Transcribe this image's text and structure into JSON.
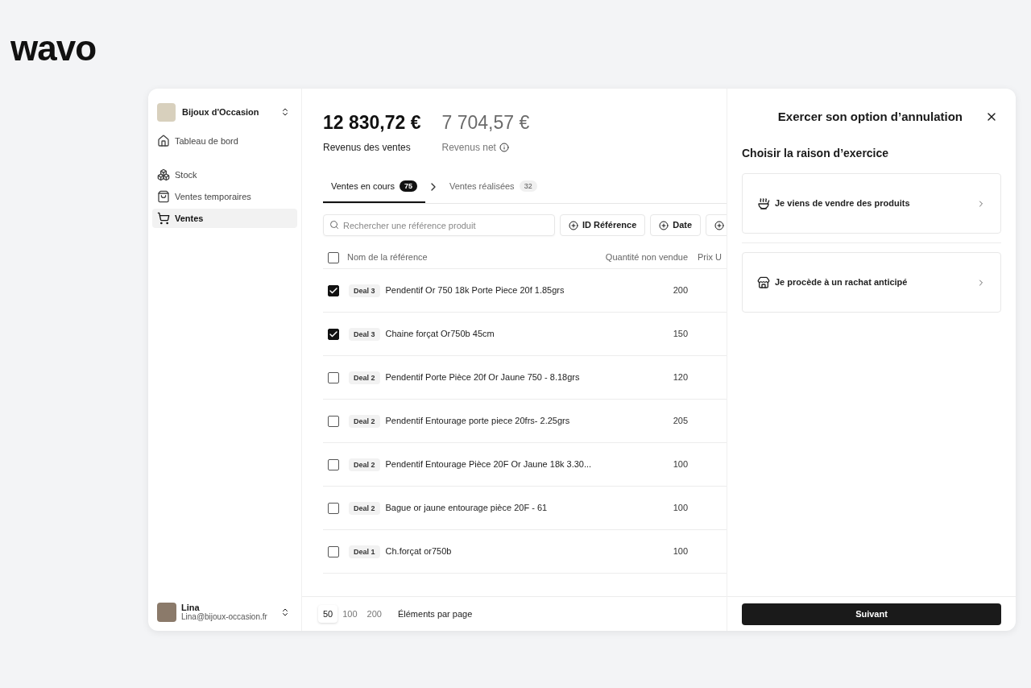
{
  "logo": "wavo",
  "sidebar": {
    "store_name": "Bijoux d'Occasion",
    "items": [
      {
        "label": "Tableau de bord",
        "selected": false
      },
      {
        "label": "Stock",
        "selected": false
      },
      {
        "label": "Ventes temporaires",
        "selected": false
      },
      {
        "label": "Ventes",
        "selected": true
      }
    ],
    "user": {
      "name": "Lina",
      "email": "Lina@bijoux-occasion.fr"
    }
  },
  "stats": [
    {
      "value": "12 830,72 €",
      "label": "Revenus des ventes"
    },
    {
      "value": "7 704,57 €",
      "label": "Revenus net"
    }
  ],
  "tabs": [
    {
      "label": "Ventes en cours",
      "count": "75",
      "selected": true
    },
    {
      "label": "Ventes réalisées",
      "count": "32",
      "selected": false
    }
  ],
  "search": {
    "placeholder": "Rechercher une référence produit"
  },
  "filters": [
    "ID Référence",
    "Date"
  ],
  "table": {
    "select_all": false,
    "columns": [
      "Nom de la référence",
      "Quantité non vendue",
      "Prix U"
    ],
    "rows": [
      {
        "checked": true,
        "deal": "Deal 3",
        "name": "Pendentif Or 750 18k Porte Piece 20f 1.85grs",
        "quantity": "200"
      },
      {
        "checked": true,
        "deal": "Deal 3",
        "name": "Chaine forçat Or750b 45cm",
        "quantity": "150"
      },
      {
        "checked": false,
        "deal": "Deal 2",
        "name": "Pendentif Porte Pièce 20f Or Jaune 750 - 8.18grs",
        "quantity": "120"
      },
      {
        "checked": false,
        "deal": "Deal 2",
        "name": "Pendentif Entourage porte piece 20frs- 2.25grs",
        "quantity": "205"
      },
      {
        "checked": false,
        "deal": "Deal 2",
        "name": "Pendentif Entourage Pièce 20F Or Jaune 18k 3.30...",
        "quantity": "100"
      },
      {
        "checked": false,
        "deal": "Deal 2",
        "name": "Bague or jaune entourage pièce 20F - 61",
        "quantity": "100"
      },
      {
        "checked": false,
        "deal": "Deal 1",
        "name": "Ch.forçat or750b",
        "quantity": "100"
      }
    ]
  },
  "pagination": {
    "options": [
      {
        "label": "50",
        "selected": true
      },
      {
        "label": "100",
        "selected": false
      },
      {
        "label": "200",
        "selected": false
      }
    ],
    "label": "Éléments par page"
  },
  "panel": {
    "title": "Exercer son option d’annulation",
    "subtitle": "Choisir la raison d’exercice",
    "options": [
      {
        "label": "Je viens de vendre des produits"
      },
      {
        "label": "Je procède à un rachat anticipé"
      }
    ],
    "button": "Suivant"
  }
}
